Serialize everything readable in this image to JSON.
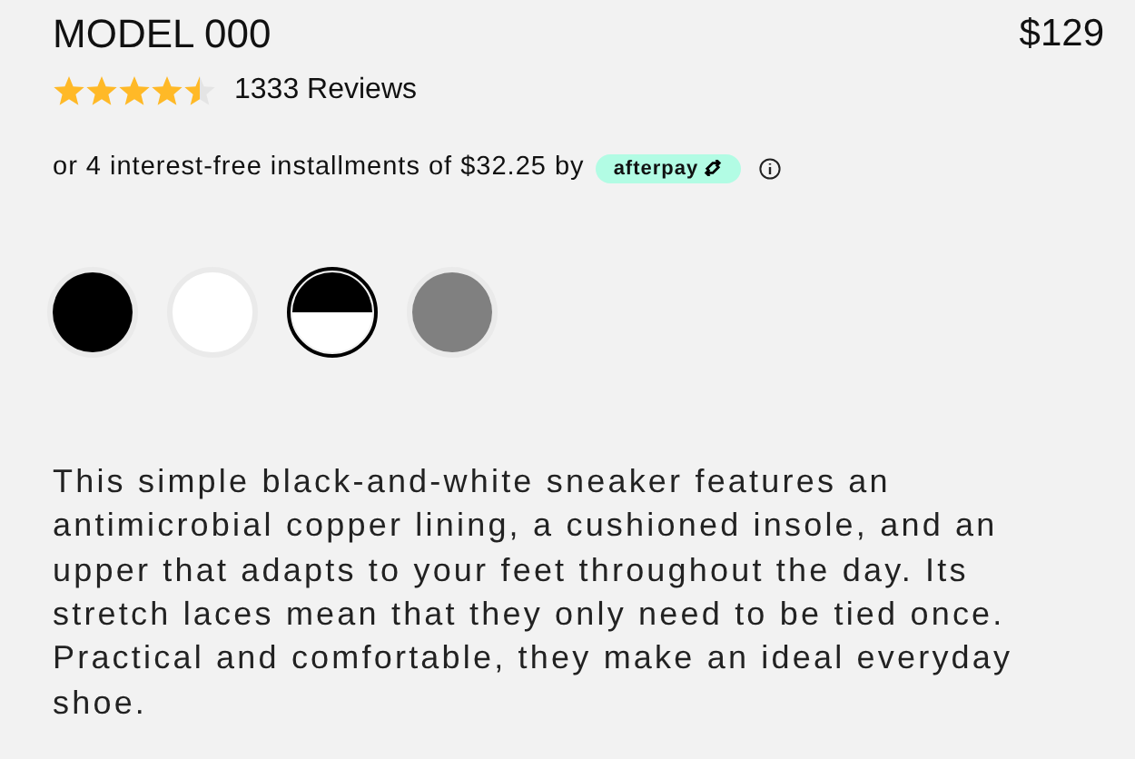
{
  "product": {
    "name": "MODEL 000",
    "price": "$129"
  },
  "rating": {
    "stars": 4.5,
    "reviews": "1333 Reviews"
  },
  "installments": {
    "text": "or 4 interest-free installments of $32.25 by",
    "badge": "afterpay"
  },
  "swatches": [
    {
      "kind": "solid",
      "color": "#000000",
      "selected": false
    },
    {
      "kind": "solid",
      "color": "#ffffff",
      "selected": false
    },
    {
      "kind": "split",
      "color": "#000000",
      "selected": true
    },
    {
      "kind": "solid",
      "color": "#808080",
      "selected": false
    }
  ],
  "description": "This simple black-and-white sneaker features an antimicrobial copper lining, a cushioned insole, and an upper that adapts to your feet throughout the day. Its stretch laces mean that they only need to be tied once. Practical and comfortable, they make an ideal everyday shoe."
}
